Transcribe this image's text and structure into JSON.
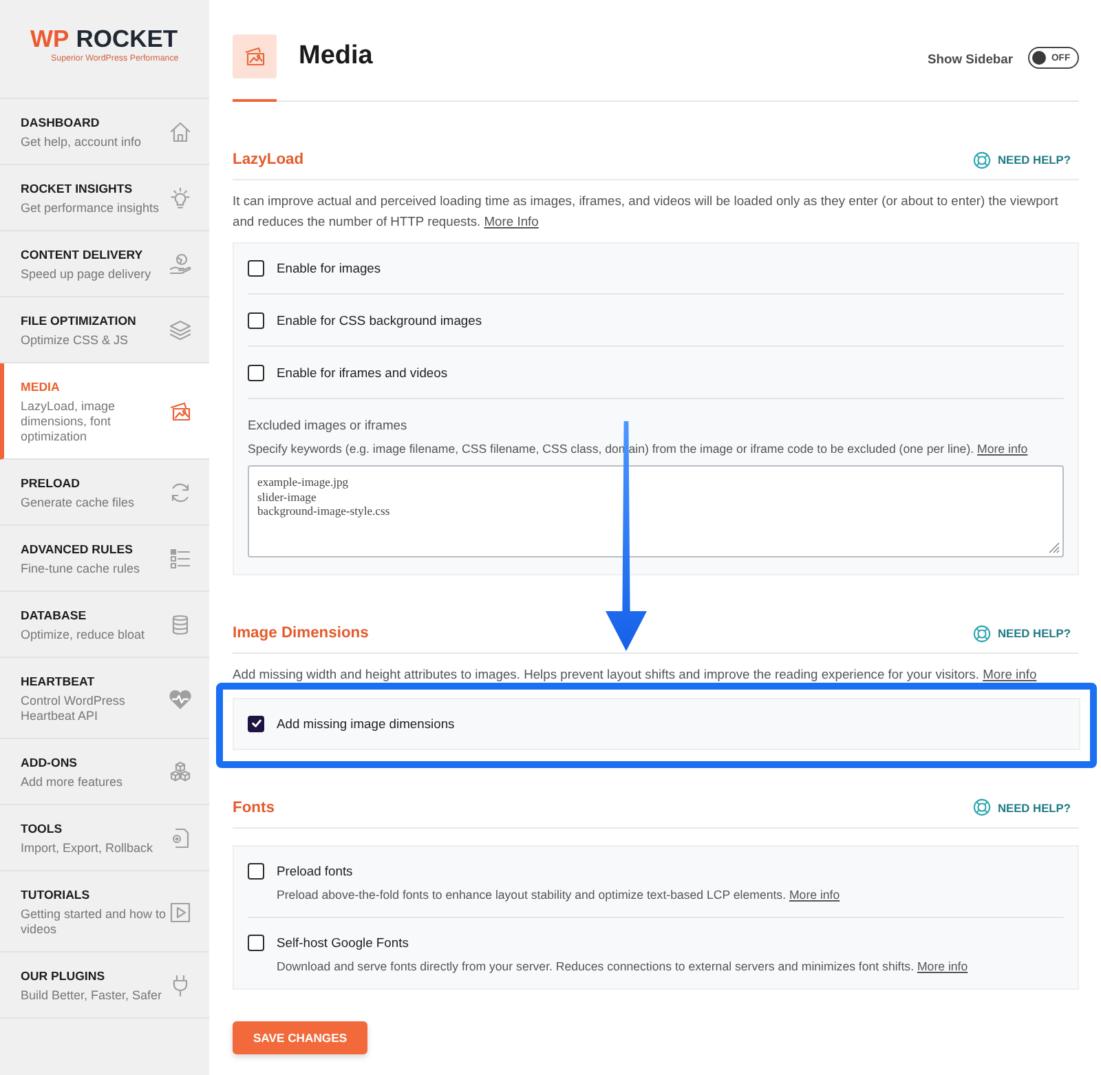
{
  "logo": {
    "prefix": "WP",
    "name": "ROCKET",
    "tagline": "Superior WordPress Performance"
  },
  "sidebar": {
    "items": [
      {
        "title": "DASHBOARD",
        "description": "Get help, account info",
        "selected": false
      },
      {
        "title": "ROCKET INSIGHTS",
        "description": "Get performance insights",
        "selected": false
      },
      {
        "title": "CONTENT DELIVERY",
        "description": "Speed up page delivery",
        "selected": false
      },
      {
        "title": "FILE OPTIMIZATION",
        "description": "Optimize CSS & JS",
        "selected": false
      },
      {
        "title": "MEDIA",
        "description": "LazyLoad, image dimensions, font optimization",
        "selected": true
      },
      {
        "title": "PRELOAD",
        "description": "Generate cache files",
        "selected": false
      },
      {
        "title": "ADVANCED RULES",
        "description": "Fine-tune cache rules",
        "selected": false
      },
      {
        "title": "DATABASE",
        "description": "Optimize, reduce bloat",
        "selected": false
      },
      {
        "title": "HEARTBEAT",
        "description": "Control WordPress Heartbeat API",
        "selected": false
      },
      {
        "title": "ADD-ONS",
        "description": "Add more features",
        "selected": false
      },
      {
        "title": "TOOLS",
        "description": "Import, Export, Rollback",
        "selected": false
      },
      {
        "title": "TUTORIALS",
        "description": "Getting started and how to videos",
        "selected": false
      },
      {
        "title": "OUR PLUGINS",
        "description": "Build Better, Faster, Safer",
        "selected": false
      }
    ]
  },
  "header": {
    "title": "Media",
    "show_sidebar": {
      "label": "Show Sidebar",
      "on": false,
      "state_text": "OFF"
    }
  },
  "sections": [
    {
      "title": "LazyLoad",
      "help": "NEED HELP?",
      "description": {
        "text": "It can improve actual and perceived loading time as images, iframes, and videos will be loaded only as they enter (or about to enter) the viewport and reduces the number of HTTP requests.",
        "link": "More Info"
      },
      "highlighted": false,
      "options": [
        {
          "kind": "checkbox",
          "label": "Enable for images",
          "checked": false
        },
        {
          "kind": "checkbox",
          "label": "Enable for CSS background images",
          "checked": false
        },
        {
          "kind": "checkbox",
          "label": "Enable for iframes and videos",
          "checked": false
        },
        {
          "kind": "textarea",
          "label": "Excluded images or iframes",
          "description": {
            "text": "Specify keywords (e.g. image filename, CSS filename, CSS class, domain) from the image or iframe code to be excluded (one per line).",
            "link": "More info"
          },
          "value": "example-image.jpg\nslider-image\nbackground-image-style.css"
        }
      ]
    },
    {
      "title": "Image Dimensions",
      "help": "NEED HELP?",
      "description": {
        "text": "Add missing width and height attributes to images. Helps prevent layout shifts and improve the reading experience for your visitors.",
        "link": "More info"
      },
      "highlighted": true,
      "options": [
        {
          "kind": "checkbox",
          "label": "Add missing image dimensions",
          "checked": true
        }
      ]
    },
    {
      "title": "Fonts",
      "help": "NEED HELP?",
      "highlighted": false,
      "options": [
        {
          "kind": "checkbox",
          "label": "Preload fonts",
          "checked": false,
          "description": {
            "text": "Preload above-the-fold fonts to enhance layout stability and optimize text-based LCP elements.",
            "link": "More info"
          }
        },
        {
          "kind": "checkbox",
          "label": "Self-host Google Fonts",
          "checked": false,
          "description": {
            "text": "Download and serve fonts directly from your server. Reduces connections to external servers and minimizes font shifts.",
            "link": "More info"
          }
        }
      ]
    }
  ],
  "save_button": "SAVE CHANGES"
}
